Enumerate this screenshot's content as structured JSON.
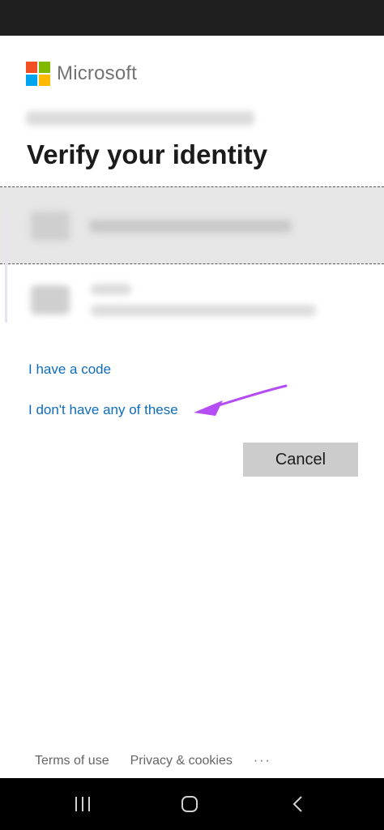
{
  "brand": {
    "name": "Microsoft",
    "colors": {
      "red": "#f25022",
      "green": "#7fba00",
      "blue": "#00a4ef",
      "yellow": "#ffb900"
    }
  },
  "page": {
    "title": "Verify your identity"
  },
  "links": {
    "have_code": "I have a code",
    "dont_have": "I don't have any of these"
  },
  "buttons": {
    "cancel": "Cancel"
  },
  "footer": {
    "terms": "Terms of use",
    "privacy": "Privacy & cookies",
    "more": "···"
  },
  "icons": {
    "nav_recents": "recent-apps-icon",
    "nav_home": "home-icon",
    "nav_back": "back-icon",
    "annotation": "arrow-icon"
  },
  "colors": {
    "link": "#0f6cbd",
    "annotation_arrow": "#b54df5",
    "selected_option_bg": "#e6e6e6",
    "cancel_bg": "#cccccc"
  }
}
